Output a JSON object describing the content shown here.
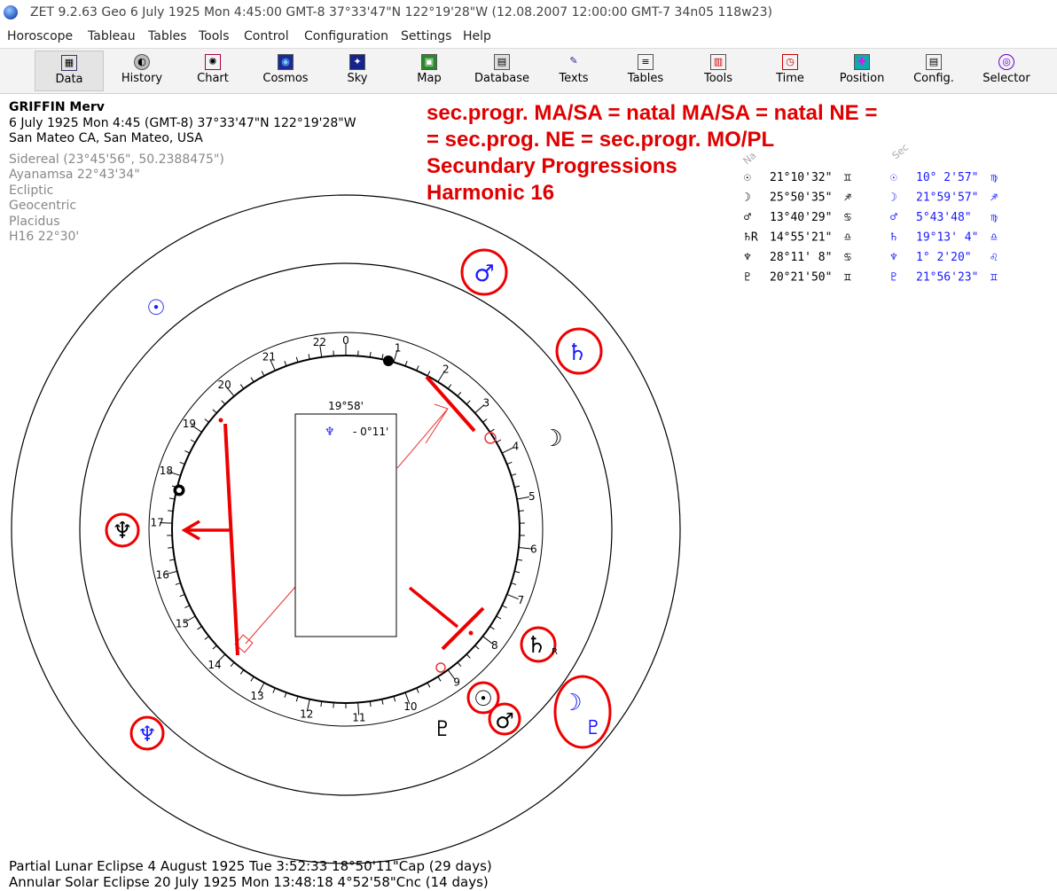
{
  "window": {
    "title": "ZET 9.2.63 Geo    6 July 1925  Mon    4:45:00 GMT-8 37°33'47\"N  122°19'28\"W  (12.08.2007  12:00:00 GMT-7 34n05 118w23)"
  },
  "menu": [
    "Horoscope",
    "Tableau",
    "Tables",
    "Tools",
    "Control",
    "Configuration",
    "Settings",
    "Help"
  ],
  "toolbar": [
    {
      "label": "Data",
      "icon": "data-icon"
    },
    {
      "label": "History",
      "icon": "history-icon"
    },
    {
      "label": "Chart",
      "icon": "chart-icon"
    },
    {
      "label": "Cosmos",
      "icon": "cosmos-icon"
    },
    {
      "label": "Sky",
      "icon": "sky-icon"
    },
    {
      "label": "Map",
      "icon": "map-icon"
    },
    {
      "label": "Database",
      "icon": "database-icon"
    },
    {
      "label": "Texts",
      "icon": "texts-icon"
    },
    {
      "label": "Tables",
      "icon": "tables-icon"
    },
    {
      "label": "Tools",
      "icon": "tools-icon"
    },
    {
      "label": "Time",
      "icon": "time-icon"
    },
    {
      "label": "Position",
      "icon": "position-icon"
    },
    {
      "label": "Config.",
      "icon": "config-icon"
    },
    {
      "label": "Selector",
      "icon": "selector-icon"
    }
  ],
  "info": {
    "name": "GRIFFIN Merv",
    "datetime": "6 July 1925  Mon   4:45 (GMT-8) 37°33'47\"N  122°19'28\"W",
    "place": "San Mateo CA, San Mateo, USA",
    "settings": [
      "Sidereal (23°45'56\", 50.2388475\")",
      "Ayanamsa 22°43'34\"",
      "Ecliptic",
      "Geocentric",
      "Placidus",
      "H16  22°30'"
    ]
  },
  "annotation": [
    "sec.progr. MA/SA = natal MA/SA = natal NE =",
    "= sec.prog. NE = sec.progr. MO/PL",
    "Secundary Progressions",
    "Harmonic 16"
  ],
  "table": {
    "col_natal": "Na",
    "col_sec": "Sec",
    "rows": [
      {
        "glyph": "☉",
        "natal": "21°10'32\"",
        "natal_sign": "♊",
        "sec": "10° 2'57\"",
        "sec_sign": "♍"
      },
      {
        "glyph": "☽",
        "natal": "25°50'35\"",
        "natal_sign": "♐",
        "sec": "21°59'57\"",
        "sec_sign": "♐"
      },
      {
        "glyph": "♂",
        "natal": "13°40'29\"",
        "natal_sign": "♋",
        "sec": " 5°43'48\"",
        "sec_sign": "♍"
      },
      {
        "glyph": "♄",
        "natal_glyph": "♄R",
        "natal": "14°55'21\"",
        "natal_sign": "♎",
        "sec": "19°13' 4\"",
        "sec_sign": "♎"
      },
      {
        "glyph": "♆",
        "natal": "28°11' 8\"",
        "natal_sign": "♋",
        "sec": " 1° 2'20\"",
        "sec_sign": "♌"
      },
      {
        "glyph": "♇",
        "natal": "20°21'50\"",
        "natal_sign": "♊",
        "sec": "21°56'23\"",
        "sec_sign": "♊"
      }
    ]
  },
  "center_box": {
    "title": "19°58'",
    "glyph": "♆",
    "value": "- 0°11'"
  },
  "dial_labels": [
    "0",
    "1",
    "2",
    "3",
    "4",
    "5",
    "6",
    "7",
    "8",
    "9",
    "10",
    "11",
    "12",
    "13",
    "14",
    "15",
    "16",
    "17",
    "18",
    "19",
    "20",
    "21",
    "22"
  ],
  "planets": {
    "sun_natal": "☉",
    "moon_natal": "☽",
    "mars_natal": "♂",
    "saturn_natal": "♄",
    "saturn_r": "R",
    "neptune_natal": "♆",
    "pluto_natal": "♇",
    "sun_sec": "☉",
    "moon_sec": "☽",
    "mars_sec": "♂",
    "saturn_sec": "♄",
    "neptune_sec": "♆",
    "pluto_sec": "♇"
  },
  "footer": [
    "Partial Lunar Eclipse 4 August 1925 Tue  3:52:33 18°50'11\"Cap (29 days)",
    "Annular Solar Eclipse 20 July 1925 Mon 13:48:18  4°52'58\"Cnc (14 days)"
  ],
  "colors": {
    "annotation": "#e00000",
    "secondary": "#1a1aff",
    "natal": "#000000",
    "settings": "#888888"
  }
}
